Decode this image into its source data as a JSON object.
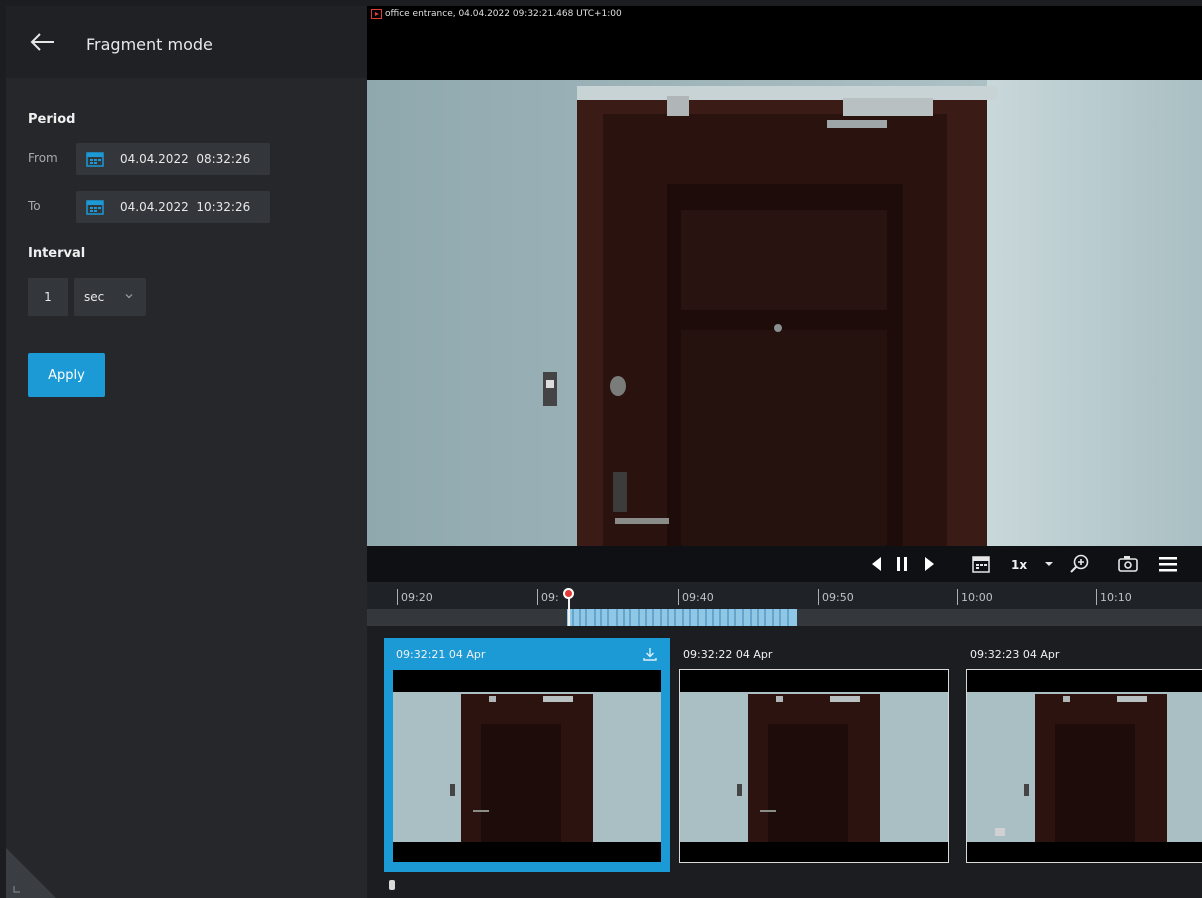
{
  "sidebar": {
    "title": "Fragment mode",
    "period_label": "Period",
    "from_label": "From",
    "from_value": "04.04.2022  08:32:26",
    "to_label": "To",
    "to_value": "04.04.2022  10:32:26",
    "interval_label": "Interval",
    "interval_value": "1",
    "interval_unit": "sec",
    "apply_label": "Apply"
  },
  "video": {
    "caption": "office entrance, 04.04.2022 09:32:21.468 UTC+1:00",
    "speed": "1x"
  },
  "timeline": {
    "ticks": [
      "09:20",
      "09:",
      "09:40",
      "09:50",
      "10:00",
      "10:10"
    ]
  },
  "thumbnails": [
    {
      "label": "09:32:21 04 Apr",
      "selected": true
    },
    {
      "label": "09:32:22 04 Apr",
      "selected": false
    },
    {
      "label": "09:32:23 04 Apr",
      "selected": false
    }
  ],
  "colors": {
    "accent": "#1b9ad6",
    "playhead": "#e23b36",
    "panel": "#25272b"
  }
}
